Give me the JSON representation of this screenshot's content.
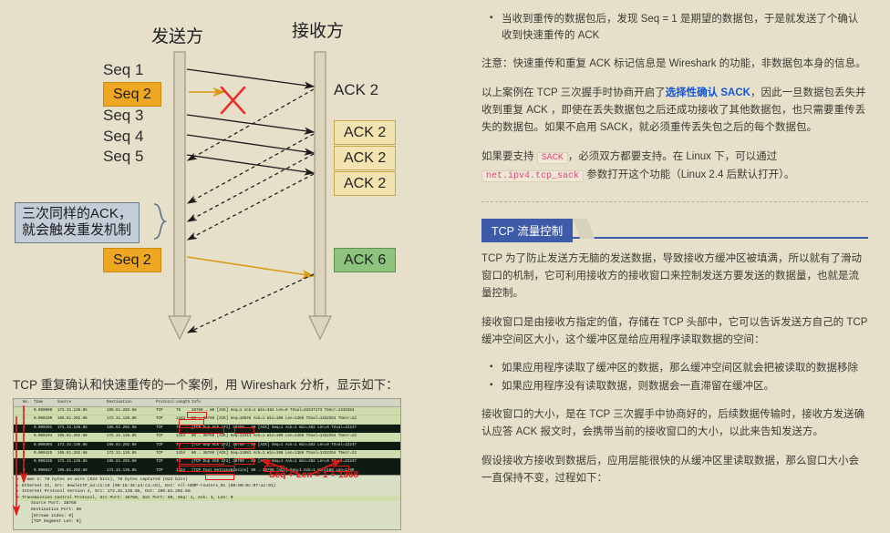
{
  "diagram": {
    "sender_label": "发送方",
    "receiver_label": "接收方",
    "sender_seqs": [
      "Seq 1",
      "Seq 2",
      "Seq 3",
      "Seq 4",
      "Seq 5"
    ],
    "highlighted_seq": "Seq 2",
    "retransmit_seq": "Seq 2",
    "receiver_acks": [
      "ACK 2",
      "ACK 2",
      "ACK 2",
      "ACK 2"
    ],
    "final_ack": "ACK 6",
    "callout": "三次同样的ACK，\n就会触发重发机制",
    "callout_line1": "三次同样的ACK，",
    "callout_line2": "就会触发重发机制",
    "colors": {
      "background": "#e6e0cb",
      "orange_chip": "#efa721",
      "yellow_chip": "#f3e3b0",
      "green_chip": "#8dc37c",
      "callout_bg": "#c2cdd8",
      "loss_cross": "#e8312a",
      "retransmit_arrow": "#d99a13"
    }
  },
  "caption": "TCP 重复确认和快速重传的一个案例，用 Wireshark 分析，显示如下：",
  "wireshark": {
    "columns": [
      "No.",
      "Time",
      "Source",
      "Destination",
      "Protocol",
      "Length",
      "Info"
    ],
    "rows": [
      {
        "no": "1",
        "time": "0.000000",
        "src": "172.31.136.85",
        "dst": "195.81.202.68",
        "proto": "TCP",
        "len": "78",
        "info": "38760 → 80 [ACK] Seq=1 Ack=1 Win=382 Len=0 TSval=22247173 TSecr=1332354",
        "style": "light"
      },
      {
        "no": "2",
        "time": "0.000190",
        "src": "195.81.202.68",
        "dst": "172.31.136.85",
        "proto": "TCP",
        "len": "1434",
        "info": "80 → 38760 [ACK] Seq=10945 Ack=1 Win=108 Len=1368 TSval=1332354 TSecr=22",
        "style": "light"
      },
      {
        "no": "3",
        "time": "0.000201",
        "src": "172.31.136.85",
        "dst": "195.81.202.68",
        "proto": "TCP",
        "len": "78",
        "info": "[TCP Dup ACK 1#1] 38760 → 80 [ACK] Seq=1 Ack=1 Win=382 Len=0 TSval=22247",
        "style": "dark"
      },
      {
        "no": "4",
        "time": "0.000294",
        "src": "195.81.202.68",
        "dst": "172.31.136.85",
        "proto": "TCP",
        "len": "1434",
        "info": "80 → 38760 [ACK] Seq=12313 Ack=1 Win=108 Len=1368 TSval=1332354 TSecr=22",
        "style": "light"
      },
      {
        "no": "5",
        "time": "0.000304",
        "src": "172.31.136.85",
        "dst": "195.81.202.68",
        "proto": "TCP",
        "len": "78",
        "info": "[TCP Dup ACK 1#2] 38760 → 80 [ACK] Seq=1 Ack=1 Win=382 Len=0 TSval=22247",
        "style": "dark"
      },
      {
        "no": "6",
        "time": "0.000425",
        "src": "195.81.202.68",
        "dst": "172.31.136.85",
        "proto": "TCP",
        "len": "1434",
        "info": "80 → 38760 [ACK] Seq=13681 Ack=1 Win=108 Len=1368 TSval=1332354 TSecr=22",
        "style": "light"
      },
      {
        "no": "7",
        "time": "0.000435",
        "src": "172.31.136.85",
        "dst": "195.81.202.68",
        "proto": "TCP",
        "len": "78",
        "info": "[TCP Dup ACK 1#3] 38760 → 80 [ACK] Seq=1 Ack=1 Win=382 Len=0 TSval=22247",
        "style": "dark"
      },
      {
        "no": "8",
        "time": "0.000527",
        "src": "195.81.202.68",
        "dst": "172.31.136.85",
        "proto": "TCP",
        "len": "1434",
        "info": "[TCP Fast Retransmission] 80 → 38760 [ACK] Seq=1 Ack=1 Win=108 Len=1368",
        "style": "dark"
      },
      {
        "no": "9",
        "time": "0.000537",
        "src": "172.31.136.85",
        "dst": "195.81.202.68",
        "proto": "TCP",
        "len": "78",
        "info": "38760 → 80 [ACK] Seq=1 Ack=1369 Win=161 Len=0 TSval=22247171 TSecr=13323",
        "style": "light"
      },
      {
        "no": "10",
        "time": "0.000652",
        "src": "195.81.202.68",
        "dst": "172.31.136.85",
        "proto": "TCP",
        "len": "1434",
        "info": "80 → 38760 [ACK] Seq=15049 Ack=1 Win=108 Len=1368 TSval=1332354 TSecr=22",
        "style": "light"
      }
    ],
    "detail": [
      "Frame 1: 78 bytes on wire (624 bits), 78 bytes captured (624 bits)",
      "Ethernet II, Src: HewlettP_a4:c1:c6 (00:16:35:a4:c1:c6), Dst: All-HSRP-routers_01 (00:00:0c:07:ac:01)",
      "Internet Protocol Version 4, Src: 172.31.136.85, Dst: 195.81.202.68",
      "Transmission Control Protocol, Src Port: 38760, Dst Port: 80, Seq: 1, Ack: 1, Len: 0",
      "Source Port: 38760",
      "Destination Port: 80",
      "[Stream index: 0]",
      "[TCP Segment Len: 0]"
    ],
    "annotation": "Seq + Len = 1 + 1368"
  },
  "article": {
    "bullet_1": "当收到重传的数据包后，发现 Seq = 1 是期望的数据包，于是就发送了个确认收到快速重传的 ACK",
    "note": "注意：快速重传和重复 ACK 标记信息是 Wireshark 的功能，非数据包本身的信息。",
    "para_sack_1": "以上案例在 TCP 三次握手时协商开启了",
    "link_sack": "选择性确认 SACK",
    "para_sack_2": "，因此一旦数据包丢失并收到重复 ACK ，即使在丢失数据包之后还成功接收了其他数据包，也只需要重传丢失的数据包。如果不启用 SACK，就必须重传丢失包之后的每个数据包。",
    "para_linux_1": "如果要支持",
    "code_sack": "SACK",
    "para_linux_2": "，必须双方都要支持。在 Linux 下，可以通过",
    "code_param": "net.ipv4.tcp_sack",
    "para_linux_3": "参数打开这个功能（Linux 2.4 后默认打开）。",
    "section_title": "TCP 流量控制",
    "para_fc_1": "TCP 为了防止发送方无脑的发送数据，导致接收方缓冲区被填满，所以就有了滑动窗口的机制，它可利用接收方的接收窗口来控制发送方要发送的数据量，也就是流量控制。",
    "para_fc_2": "接收窗口是由接收方指定的值，存储在 TCP 头部中，它可以告诉发送方自己的 TCP 缓冲空间区大小，这个缓冲区是给应用程序读取数据的空间：",
    "bullet_fc_1": "如果应用程序读取了缓冲区的数据，那么缓冲空间区就会把被读取的数据移除",
    "bullet_fc_2": "如果应用程序没有读取数据，则数据会一直滞留在缓冲区。",
    "para_fc_3": "接收窗口的大小，是在 TCP 三次握手中协商好的，后续数据传输时，接收方发送确认应答 ACK 报文时，会携带当前的接收窗口的大小，以此来告知发送方。",
    "para_fc_4": "假设接收方接收到数据后，应用层能很快的从缓冲区里读取数据，那么窗口大小会一直保持不变，过程如下："
  }
}
